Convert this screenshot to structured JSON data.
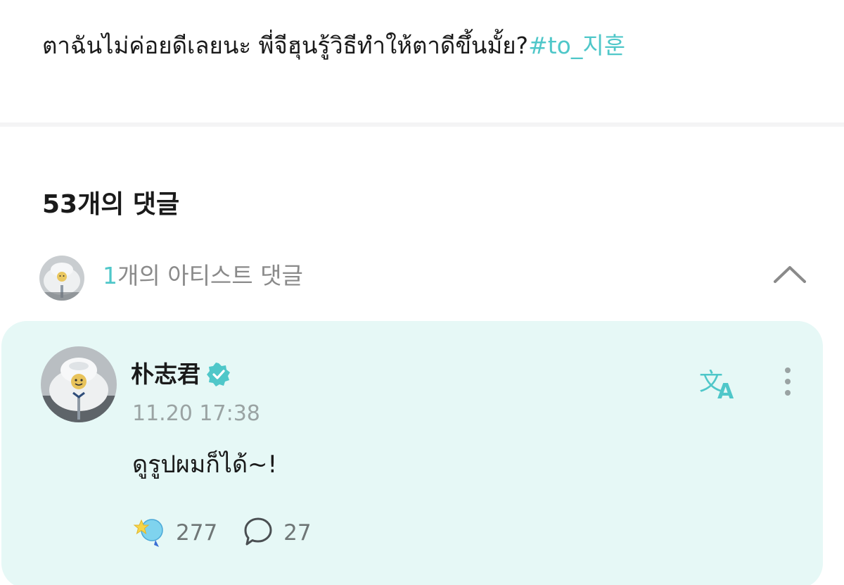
{
  "post": {
    "text": "ตาฉันไม่ค่อยดีเลยนะ พี่จีฮุนรู้วิธีทำให้ตาดีขึ้นมั้ย?",
    "hashtag": "#to_지훈"
  },
  "comments": {
    "title": "53개의 댓글",
    "artist_summary": {
      "count": "1",
      "label": "개의 아티스트 댓글",
      "collapse_icon": "chevron-up-icon"
    }
  },
  "artist_comment": {
    "author": "朴志君",
    "verified_icon": "verified-badge-icon",
    "time": "11.20 17:38",
    "text": "ดูรูปผมก็ได้~!",
    "likes": "277",
    "replies": "27",
    "icons": {
      "translate": "translate-icon",
      "more": "more-vertical-icon",
      "like": "star-lightstick-icon",
      "reply": "speech-bubble-icon"
    }
  },
  "colors": {
    "accent": "#4fc7c9",
    "card_bg": "#e6f8f6",
    "muted": "#8a8a8a"
  }
}
